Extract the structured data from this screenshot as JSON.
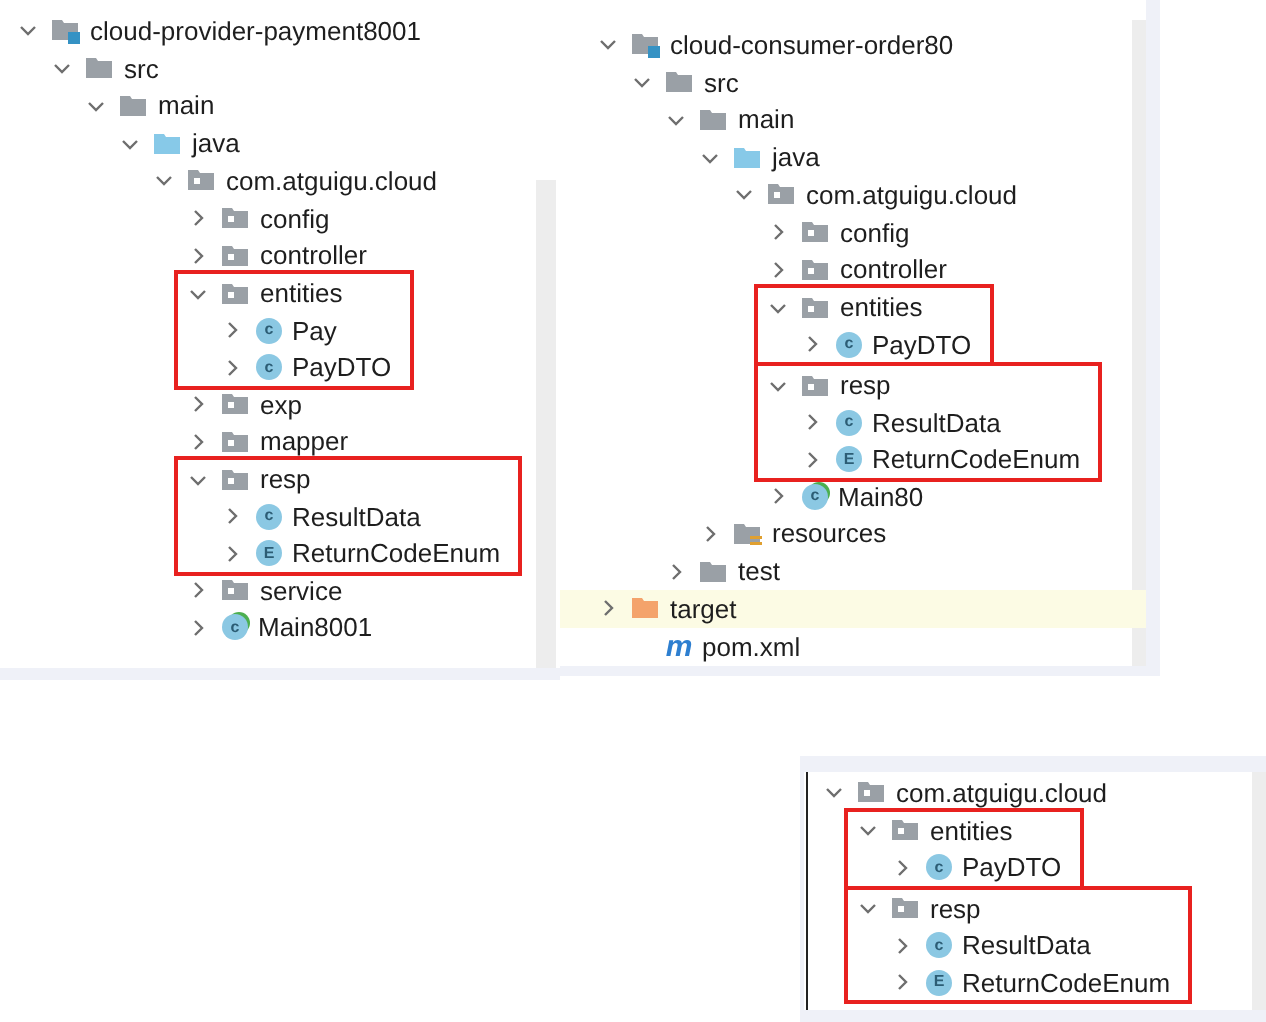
{
  "panels": [
    {
      "tree": [
        {
          "label": "cloud-provider-payment8001",
          "kind": "module",
          "expanded": true,
          "children": [
            {
              "label": "src",
              "kind": "folder",
              "expanded": true,
              "children": [
                {
                  "label": "main",
                  "kind": "folder",
                  "expanded": true,
                  "children": [
                    {
                      "label": "java",
                      "kind": "source",
                      "expanded": true,
                      "children": [
                        {
                          "label": "com.atguigu.cloud",
                          "kind": "package",
                          "expanded": true,
                          "children": [
                            {
                              "label": "config",
                              "kind": "package",
                              "expanded": false
                            },
                            {
                              "label": "controller",
                              "kind": "package",
                              "expanded": false
                            },
                            {
                              "label": "entities",
                              "kind": "package",
                              "expanded": true,
                              "highlighted": true,
                              "children": [
                                {
                                  "label": "Pay",
                                  "kind": "class",
                                  "icon_letter": "c",
                                  "expanded": false
                                },
                                {
                                  "label": "PayDTO",
                                  "kind": "class",
                                  "icon_letter": "c",
                                  "expanded": false
                                }
                              ]
                            },
                            {
                              "label": "exp",
                              "kind": "package",
                              "expanded": false
                            },
                            {
                              "label": "mapper",
                              "kind": "package",
                              "expanded": false
                            },
                            {
                              "label": "resp",
                              "kind": "package",
                              "expanded": true,
                              "highlighted": true,
                              "children": [
                                {
                                  "label": "ResultData",
                                  "kind": "class",
                                  "icon_letter": "c",
                                  "expanded": false
                                },
                                {
                                  "label": "ReturnCodeEnum",
                                  "kind": "class",
                                  "icon_letter": "E",
                                  "expanded": false
                                }
                              ]
                            },
                            {
                              "label": "service",
                              "kind": "package",
                              "expanded": false
                            },
                            {
                              "label": "Main8001",
                              "kind": "main",
                              "icon_letter": "c",
                              "expanded": false
                            }
                          ]
                        }
                      ]
                    }
                  ]
                }
              ]
            }
          ]
        }
      ]
    },
    {
      "tree": [
        {
          "label": "cloud-consumer-order80",
          "kind": "module",
          "expanded": true,
          "children": [
            {
              "label": "src",
              "kind": "folder",
              "expanded": true,
              "children": [
                {
                  "label": "main",
                  "kind": "folder",
                  "expanded": true,
                  "children": [
                    {
                      "label": "java",
                      "kind": "source",
                      "expanded": true,
                      "children": [
                        {
                          "label": "com.atguigu.cloud",
                          "kind": "package",
                          "expanded": true,
                          "children": [
                            {
                              "label": "config",
                              "kind": "package",
                              "expanded": false
                            },
                            {
                              "label": "controller",
                              "kind": "package",
                              "expanded": false
                            },
                            {
                              "label": "entities",
                              "kind": "package",
                              "expanded": true,
                              "highlighted": true,
                              "children": [
                                {
                                  "label": "PayDTO",
                                  "kind": "class",
                                  "icon_letter": "c",
                                  "expanded": false
                                }
                              ]
                            },
                            {
                              "label": "resp",
                              "kind": "package",
                              "expanded": true,
                              "highlighted": true,
                              "children": [
                                {
                                  "label": "ResultData",
                                  "kind": "class",
                                  "icon_letter": "c",
                                  "expanded": false
                                },
                                {
                                  "label": "ReturnCodeEnum",
                                  "kind": "class",
                                  "icon_letter": "E",
                                  "expanded": false
                                }
                              ]
                            },
                            {
                              "label": "Main80",
                              "kind": "main",
                              "icon_letter": "c",
                              "expanded": false
                            }
                          ]
                        }
                      ]
                    },
                    {
                      "label": "resources",
                      "kind": "resources",
                      "expanded": false
                    }
                  ]
                },
                {
                  "label": "test",
                  "kind": "folder",
                  "expanded": false
                }
              ]
            },
            {
              "label": "target",
              "kind": "excluded",
              "expanded": false
            },
            {
              "label": "pom.xml",
              "kind": "maven",
              "icon_letter": "m"
            }
          ]
        }
      ]
    },
    {
      "tree": [
        {
          "label": "com.atguigu.cloud",
          "kind": "package",
          "expanded": true,
          "children": [
            {
              "label": "entities",
              "kind": "package",
              "expanded": true,
              "highlighted": true,
              "children": [
                {
                  "label": "PayDTO",
                  "kind": "class",
                  "icon_letter": "c",
                  "expanded": false
                }
              ]
            },
            {
              "label": "resp",
              "kind": "package",
              "expanded": true,
              "highlighted": true,
              "children": [
                {
                  "label": "ResultData",
                  "kind": "class",
                  "icon_letter": "c",
                  "expanded": false
                },
                {
                  "label": "ReturnCodeEnum",
                  "kind": "class",
                  "icon_letter": "E",
                  "expanded": false
                }
              ]
            }
          ]
        }
      ]
    }
  ]
}
